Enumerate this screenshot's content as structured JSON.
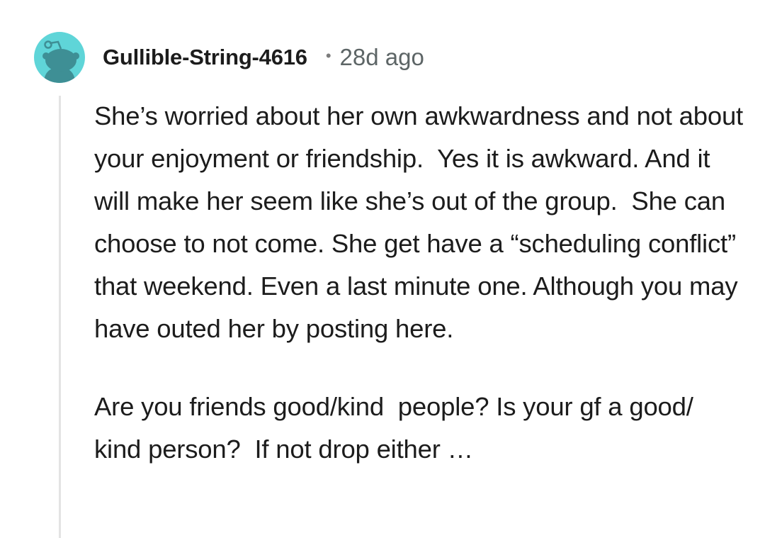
{
  "comment": {
    "author": "Gullible-String-4616",
    "separator": "•",
    "timestamp": "28d ago",
    "avatar_icon": "reddit-snoo-avatar-icon",
    "avatar_color": "#5fd5d8",
    "paragraphs": [
      "She’s worried about her own awkwardness and not about your enjoyment or friendship.  Yes it is awkward. And it will make her seem like she’s out of the group.  She can choose to not come. She get have a “scheduling conflict” that weekend. Even a last minute one. Although you may have outed her by posting here.",
      "Are you friends good/kind  people? Is your gf a good/ kind person?  If not drop either …"
    ]
  }
}
